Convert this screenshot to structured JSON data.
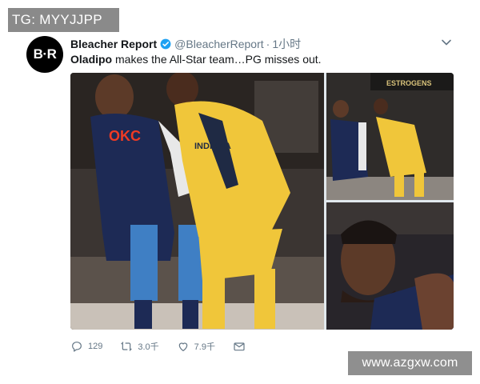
{
  "watermark_top": "TG: MYYJJPP",
  "watermark_bottom": "www.azgxw.com",
  "tweet": {
    "avatar_text": "B·R",
    "author_name": "Bleacher Report",
    "handle": "@BleacherReport",
    "separator": "·",
    "time": "1小时",
    "text_bold": "Oladipo",
    "text_rest": " makes the All-Star team…PG misses out.",
    "verified_icon": "verified-badge-icon",
    "menu_icon": "chevron-down-icon"
  },
  "media": {
    "jersey_left": "OKC",
    "jersey_right": "INDIANA",
    "arena_banner": "ESTROGENS"
  },
  "actions": {
    "replies": "129",
    "retweets": "3.0千",
    "likes": "7.9千",
    "reply_icon": "reply-icon",
    "retweet_icon": "retweet-icon",
    "like_icon": "heart-icon",
    "dm_icon": "mail-icon"
  },
  "colors": {
    "verified": "#1da1f2",
    "muted": "#657786",
    "okc_navy": "#1d2a55",
    "pacers_yellow": "#f0c63a"
  }
}
